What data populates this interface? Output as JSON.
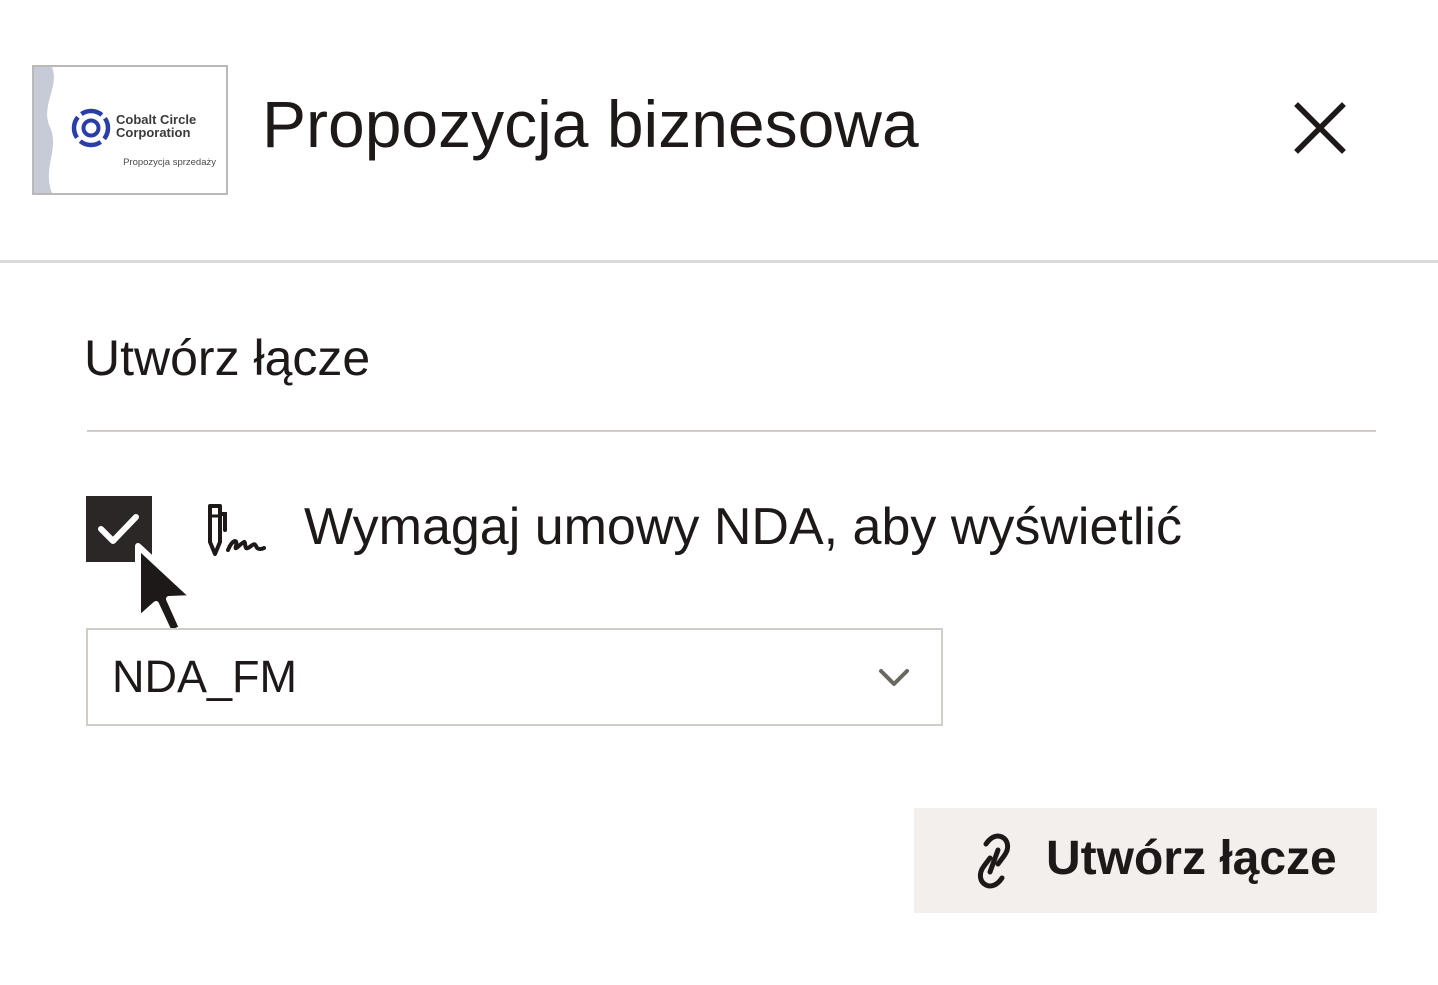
{
  "header": {
    "thumbnail": {
      "company": "Cobalt Circle Corporation",
      "subtitle": "Propozycja sprzedaży",
      "logo_color": "#2a3ea8",
      "logo_icon": "cobalt-circle-logo"
    },
    "title": "Propozycja biznesowa",
    "close_icon": "close-icon"
  },
  "create_link": {
    "section_title": "Utwórz łącze",
    "require_nda": {
      "checked": true,
      "icon": "signature-pen-icon",
      "label": "Wymagaj umowy NDA, aby wyświetlić"
    },
    "nda_select": {
      "value": "NDA_FM",
      "icon": "chevron-down-icon"
    },
    "submit_button": {
      "icon": "link-icon",
      "label": "Utwórz łącze"
    }
  },
  "colors": {
    "text": "#1e1919",
    "checkbox_fill": "#2b2727",
    "button_bg": "#f2efec",
    "divider": "#cfcdc6",
    "brand_blue": "#2a3ea8"
  }
}
